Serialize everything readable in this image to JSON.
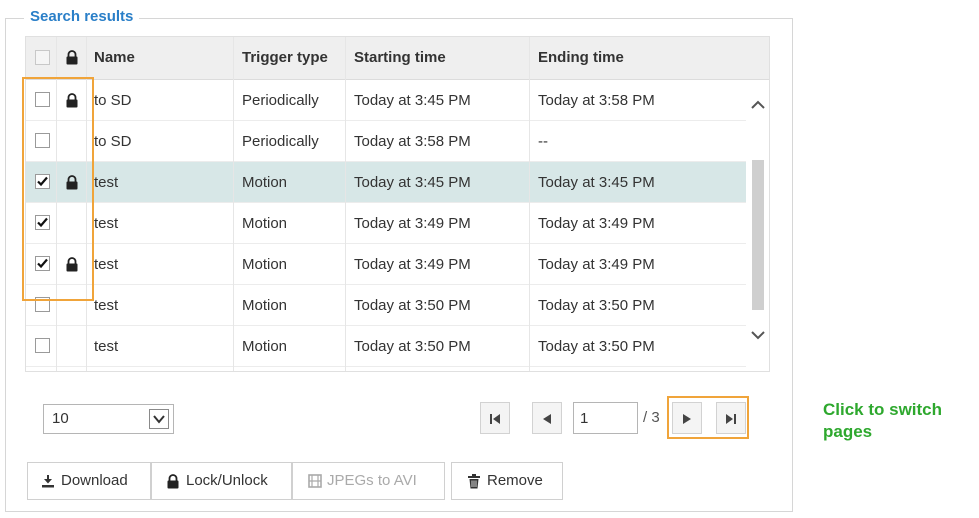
{
  "panel": {
    "title": "Search results"
  },
  "grid": {
    "columns": [
      "Name",
      "Trigger type",
      "Starting time",
      "Ending time"
    ],
    "rows": [
      {
        "name": "to SD",
        "trigger": "Periodically",
        "start": "Today at 3:45 PM",
        "end": "Today at 3:58 PM",
        "checked": false,
        "locked": true,
        "selected": false
      },
      {
        "name": "to SD",
        "trigger": "Periodically",
        "start": "Today at 3:58 PM",
        "end": "--",
        "checked": false,
        "locked": false,
        "selected": false
      },
      {
        "name": "test",
        "trigger": "Motion",
        "start": "Today at 3:45 PM",
        "end": "Today at 3:45 PM",
        "checked": true,
        "locked": true,
        "selected": true
      },
      {
        "name": "test",
        "trigger": "Motion",
        "start": "Today at 3:49 PM",
        "end": "Today at 3:49 PM",
        "checked": true,
        "locked": false,
        "selected": false
      },
      {
        "name": "test",
        "trigger": "Motion",
        "start": "Today at 3:49 PM",
        "end": "Today at 3:49 PM",
        "checked": true,
        "locked": true,
        "selected": false
      },
      {
        "name": "test",
        "trigger": "Motion",
        "start": "Today at 3:50 PM",
        "end": "Today at 3:50 PM",
        "checked": false,
        "locked": false,
        "selected": false
      },
      {
        "name": "test",
        "trigger": "Motion",
        "start": "Today at 3:50 PM",
        "end": "Today at 3:50 PM",
        "checked": false,
        "locked": false,
        "selected": false
      }
    ]
  },
  "pagination": {
    "page_size": "10",
    "current_page": "1",
    "total_pages": "/ 3"
  },
  "actions": {
    "download": "Download",
    "lock_unlock": "Lock/Unlock",
    "jpegs_to_avi": "JPEGs to AVI",
    "remove": "Remove"
  },
  "annotation": {
    "text": "Click to switch pages"
  },
  "colors": {
    "accent": "#2a7fc8",
    "highlight_box": "#f0a43a",
    "annotation": "#2ea82e",
    "selected_row": "#d7e7e7"
  },
  "icons": {
    "lock": "lock-icon",
    "check": "check-icon",
    "scroll_up": "chevron-up-icon",
    "scroll_down": "chevron-down-icon",
    "first": "first-page-icon",
    "prev": "previous-page-icon",
    "next": "next-page-icon",
    "last": "last-page-icon",
    "download": "download-icon",
    "film": "film-icon",
    "trash": "trash-icon"
  }
}
